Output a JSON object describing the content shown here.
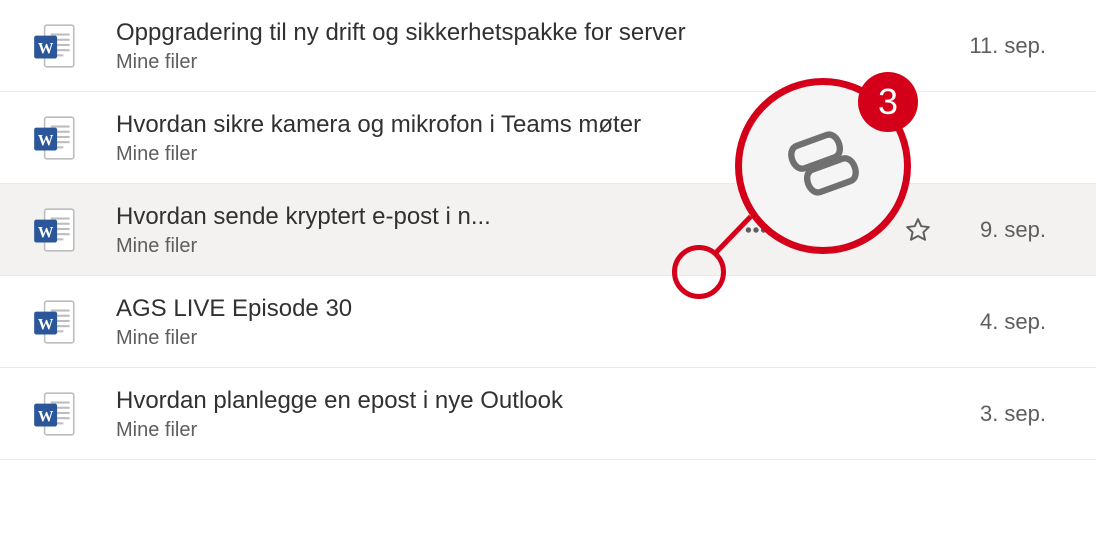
{
  "files": [
    {
      "title": "Oppgradering til ny drift og sikkerhetspakke for server",
      "location": "Mine filer",
      "date": "11. sep.",
      "hovered": false,
      "truncated": false
    },
    {
      "title": "Hvordan sikre kamera og mikrofon i Teams møter",
      "location": "Mine filer",
      "date": "",
      "hovered": false,
      "truncated": false
    },
    {
      "title": "Hvordan sende kryptert e-post i n...",
      "location": "Mine filer",
      "date": "9. sep.",
      "hovered": true,
      "truncated": true
    },
    {
      "title": "AGS LIVE Episode 30",
      "location": "Mine filer",
      "date": "4. sep.",
      "hovered": false,
      "truncated": false
    },
    {
      "title": "Hvordan planlegge en epost i nye Outlook",
      "location": "Mine filer",
      "date": "3. sep.",
      "hovered": false,
      "truncated": false
    }
  ],
  "annotation": {
    "badge_number": "3"
  }
}
